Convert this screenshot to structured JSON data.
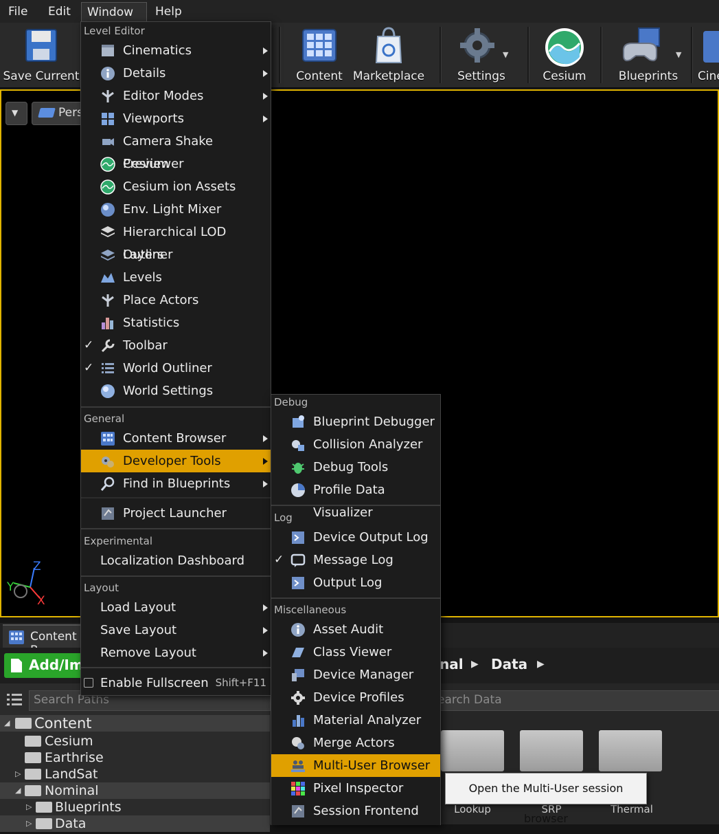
{
  "menubar": {
    "file": "File",
    "edit": "Edit",
    "window": "Window",
    "help": "Help"
  },
  "toolbar": {
    "save": "Save Current",
    "content": "Content",
    "marketplace": "Marketplace",
    "settings": "Settings",
    "cesium": "Cesium",
    "blueprints": "Blueprints",
    "cinematics": "Cine"
  },
  "viewport": {
    "perspective": "Pers",
    "axis_z": "Z",
    "axis_y": "Y",
    "axis_x": "X"
  },
  "window_menu": {
    "sections": {
      "level_editor": "Level Editor",
      "general": "General",
      "experimental": "Experimental",
      "layout": "Layout"
    },
    "level_editor_items": [
      "Cinematics",
      "Details",
      "Editor Modes",
      "Viewports",
      "Camera Shake Previewer",
      "Cesium",
      "Cesium ion Assets",
      "Env. Light Mixer",
      "Hierarchical LOD Outliner",
      "Layers",
      "Levels",
      "Place Actors",
      "Statistics",
      "Toolbar",
      "World Outliner",
      "World Settings"
    ],
    "general_items": [
      "Content Browser",
      "Developer Tools",
      "Find in Blueprints",
      "Project Launcher"
    ],
    "experimental_items": [
      "Localization Dashboard"
    ],
    "layout_items": [
      "Load Layout",
      "Save Layout",
      "Remove Layout"
    ],
    "fullscreen": "Enable Fullscreen",
    "fullscreen_shortcut": "Shift+F11",
    "check_mark": "✓"
  },
  "dev_tools_menu": {
    "sections": {
      "debug": "Debug",
      "log": "Log",
      "misc": "Miscellaneous"
    },
    "debug_items": [
      "Blueprint Debugger",
      "Collision Analyzer",
      "Debug Tools",
      "Profile Data Visualizer"
    ],
    "log_items": [
      "Device Output Log",
      "Message Log",
      "Output Log"
    ],
    "misc_items": [
      "Asset Audit",
      "Class Viewer",
      "Device Manager",
      "Device Profiles",
      "Material Analyzer",
      "Merge Actors",
      "Multi-User Browser",
      "Pixel Inspector",
      "Session Frontend"
    ]
  },
  "tooltip": "Open the Multi-User session browser",
  "content_browser": {
    "tab_label": "Content B",
    "add_button": "Add/Im",
    "search_paths_placeholder": "Search Paths",
    "search_data_placeholder": "earch Data",
    "breadcrumb_partial": "nal",
    "breadcrumb_current": "Data",
    "tree": [
      "Content",
      "Cesium",
      "Earthrise",
      "LandSat",
      "Nominal",
      "Blueprints",
      "Data"
    ],
    "folders": [
      "Lookup",
      "SRP",
      "Thermal"
    ]
  },
  "colors": {
    "accent": "#e0a000",
    "viewport_border": "#e0b400",
    "add_green": "#2aa52a"
  }
}
